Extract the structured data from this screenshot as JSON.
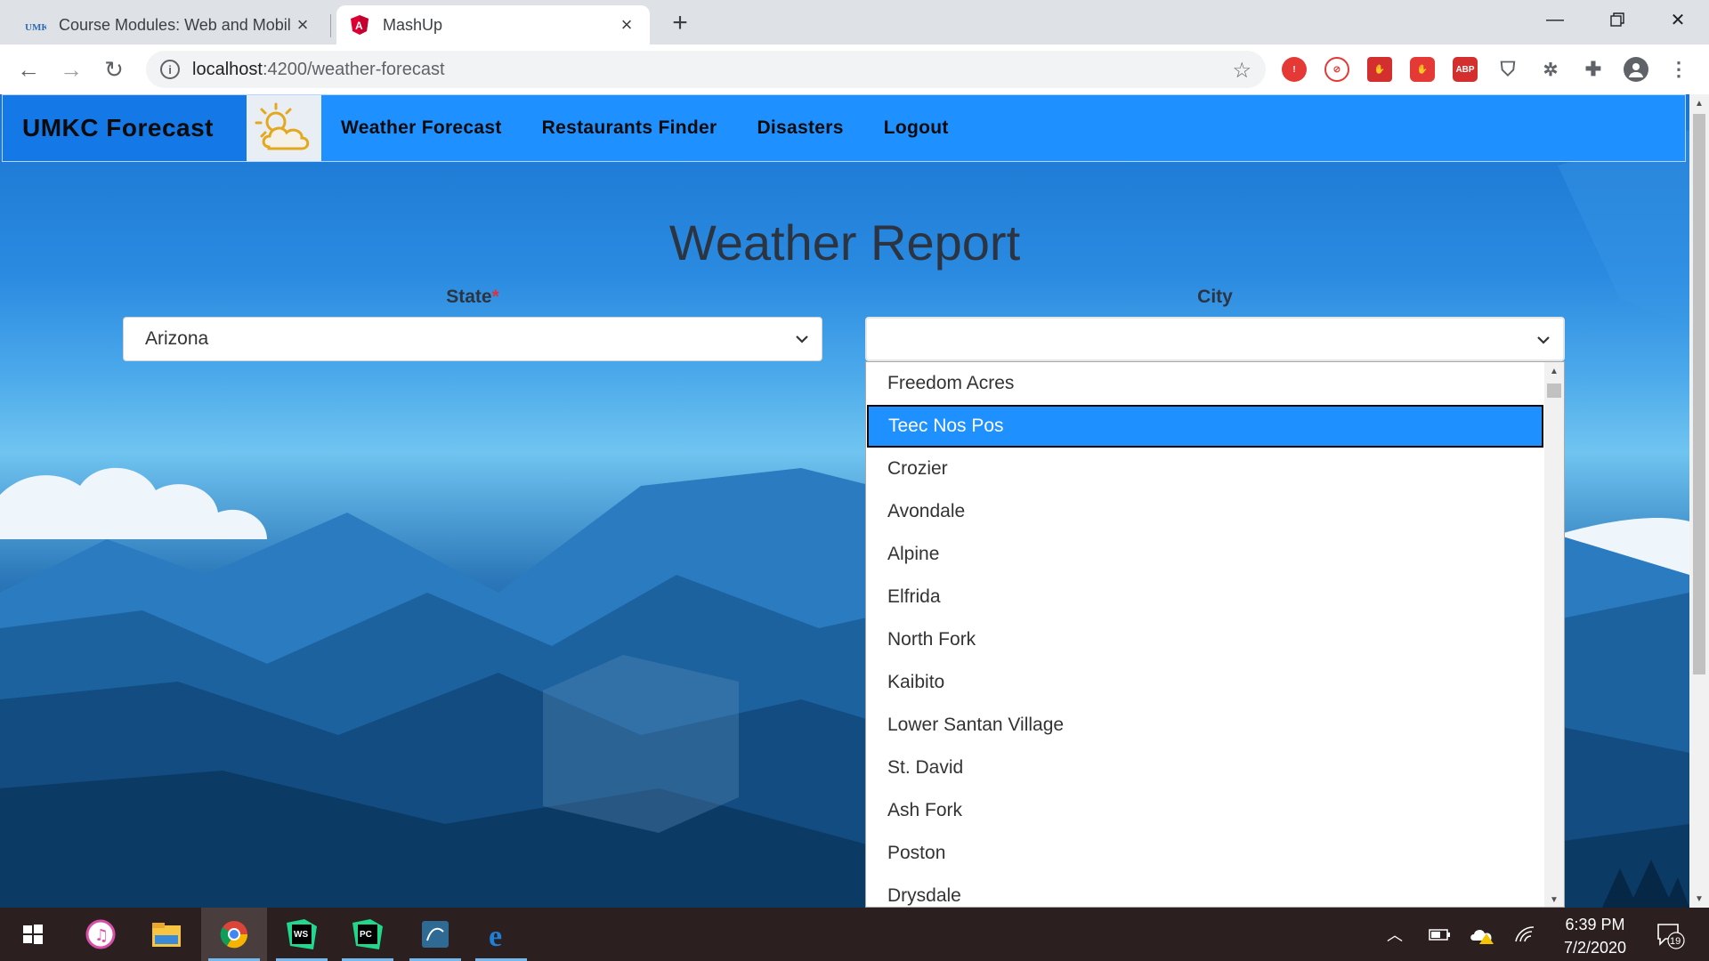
{
  "browser": {
    "tabs": [
      {
        "title": "Course Modules: Web and Mobil",
        "active": false
      },
      {
        "title": "MashUp",
        "active": true
      }
    ],
    "url_host": "localhost",
    "url_path": ":4200/weather-forecast",
    "ext_labels": [
      "ABP"
    ]
  },
  "navbar": {
    "brand": "UMKC Forecast",
    "links": [
      "Weather Forecast",
      "Restaurants Finder",
      "Disasters",
      "Logout"
    ]
  },
  "page": {
    "title": "Weather Report",
    "state": {
      "label": "State",
      "required_mark": "*",
      "value": "Arizona"
    },
    "city": {
      "label": "City",
      "value": "",
      "options": [
        "Freedom Acres",
        "Teec Nos Pos",
        "Crozier",
        "Avondale",
        "Alpine",
        "Elfrida",
        "North Fork",
        "Kaibito",
        "Lower Santan Village",
        "St. David",
        "Ash Fork",
        "Poston",
        "Drysdale"
      ],
      "highlighted_index": 1
    }
  },
  "taskbar": {
    "time": "6:39 PM",
    "date": "7/2/2020",
    "notifications": "19"
  },
  "colors": {
    "navbar": "#1e90ff",
    "highlight": "#1e90ff"
  }
}
